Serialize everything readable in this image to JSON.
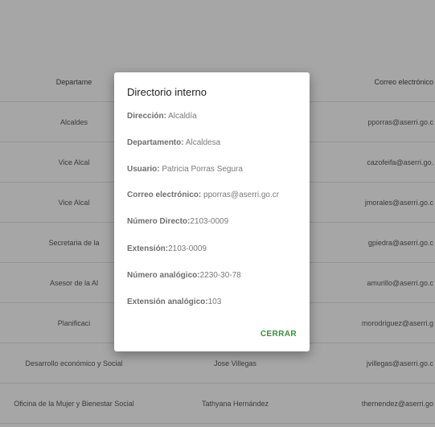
{
  "table": {
    "header": [
      "Departame",
      "",
      "Correo electrónico"
    ],
    "rows": [
      [
        "Alcaldes",
        "",
        "pporras@aserri.go.c"
      ],
      [
        "Vice Alcal",
        "",
        "cazofeifa@aserri.go."
      ],
      [
        "Vice Alcal",
        "",
        "jmorales@aserri.go.c"
      ],
      [
        "Secretaria de la",
        "",
        "gpiedra@aserri.go.c"
      ],
      [
        "Asesor de la Al",
        "",
        "amurillo@aserri.go.c"
      ],
      [
        "Planificaci",
        "",
        "morodriguez@aserri.g"
      ],
      [
        "Desarrollo económico y Social",
        "Jose Villegas",
        "jvillegas@aserri.go.c"
      ],
      [
        "Oficina de la Mujer y Bienestar Social",
        "Tathyana Hernández",
        "thernendez@aserri.go"
      ]
    ]
  },
  "dialog": {
    "title": "Directorio interno",
    "fields": [
      {
        "label": "Dirección:",
        "value": " Alcaldía"
      },
      {
        "label": "Departamento:",
        "value": " Alcaldesa"
      },
      {
        "label": "Usuario:",
        "value": " Patricia Porras Segura"
      },
      {
        "label": "Correo electrónico:",
        "value": " pporras@aserri.go.cr"
      },
      {
        "label": "Número Directo:",
        "value": "2103-0009"
      },
      {
        "label": "Extensión:",
        "value": "2103-0009"
      },
      {
        "label": "Número analógico:",
        "value": "2230-30-78"
      },
      {
        "label": "Extensión analógico:",
        "value": "103"
      }
    ],
    "close_label": "CERRAR"
  },
  "colors": {
    "accent": "#3b8c3b",
    "overlay": "rgba(0,0,0,0.35)"
  }
}
